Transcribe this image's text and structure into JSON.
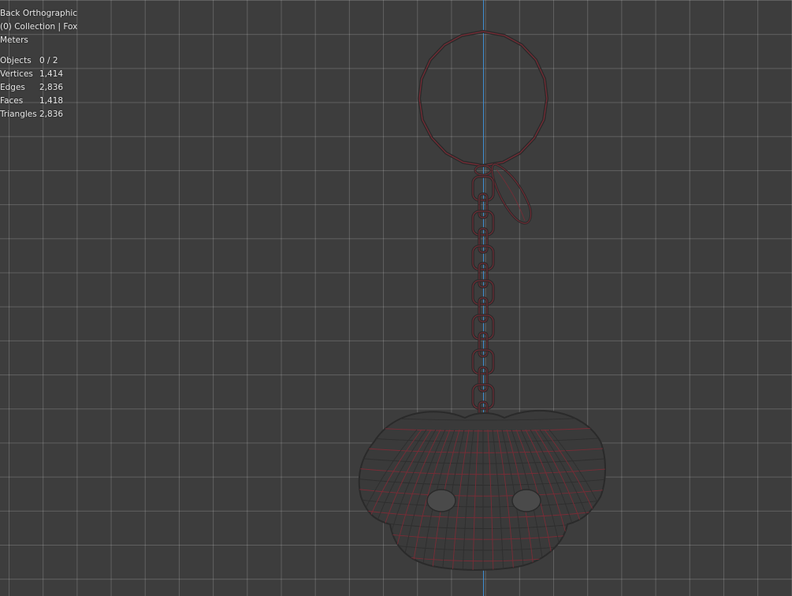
{
  "viewport": {
    "view_name": "Back Orthographic",
    "collection": "(0) Collection | Fox",
    "units": "Meters",
    "stats": [
      {
        "label": "Objects",
        "value": "0 / 2"
      },
      {
        "label": "Vertices",
        "value": "1,414"
      },
      {
        "label": "Edges",
        "value": "2,836"
      },
      {
        "label": "Faces",
        "value": "1,418"
      },
      {
        "label": "Triangles",
        "value": "2,836"
      }
    ]
  },
  "colors": {
    "background": "#3d3d3d",
    "grid": "#5a5a5a",
    "axis": "#3f8fd4",
    "wire_dark": "#2a2a2a",
    "wire_red": "#7a2c36"
  }
}
